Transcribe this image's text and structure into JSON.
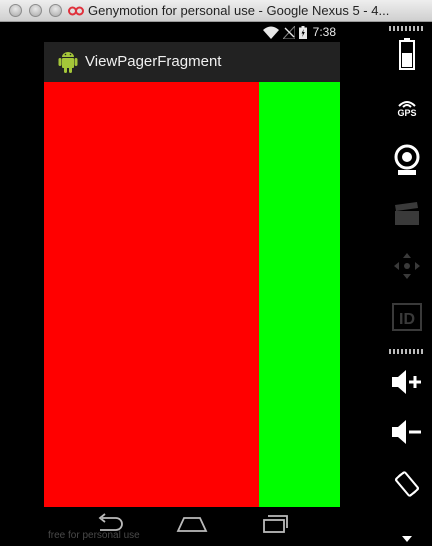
{
  "window": {
    "title": "Genymotion for personal use - Google Nexus 5 - 4..."
  },
  "status_bar": {
    "time": "7:38"
  },
  "action_bar": {
    "title": "ViewPagerFragment"
  },
  "pager": {
    "pages": [
      {
        "color": "#ff0000"
      },
      {
        "color": "#00ff00"
      }
    ]
  },
  "footer": {
    "watermark": "free for personal use"
  },
  "toolbar": {
    "gps_label": "GPS",
    "id_label": "ID",
    "items": [
      "battery-icon",
      "gps-icon",
      "webcam-icon",
      "video-capture-icon",
      "dpad-icon",
      "device-id-icon",
      "volume-up-icon",
      "volume-down-icon",
      "rotate-icon"
    ]
  },
  "colors": {
    "action_bar": "#222222",
    "toolbar_icon": "#ffffff",
    "toolbar_icon_disabled": "#3a3a3a"
  }
}
